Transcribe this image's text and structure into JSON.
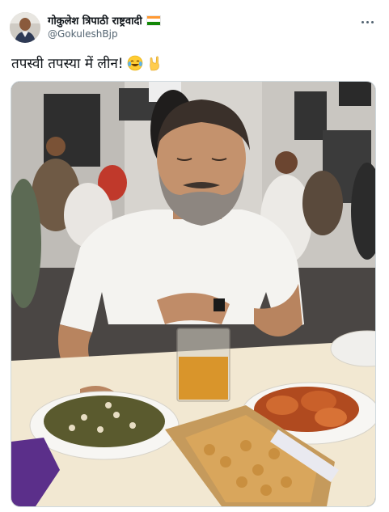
{
  "author": {
    "display_name": "गोकुलेश त्रिपाठी राष्ट्रवादी",
    "handle": "@GokuleshBjp",
    "flag_colors": [
      "#ff9933",
      "#ffffff",
      "#138808"
    ]
  },
  "tweet": {
    "text": "तपस्वी तपस्या में लीन!",
    "emojis": [
      "tears-of-joy-emoji",
      "rock-on-hand-emoji"
    ]
  },
  "icons": {
    "more": "more-options-icon"
  },
  "media": {
    "type": "photo"
  }
}
